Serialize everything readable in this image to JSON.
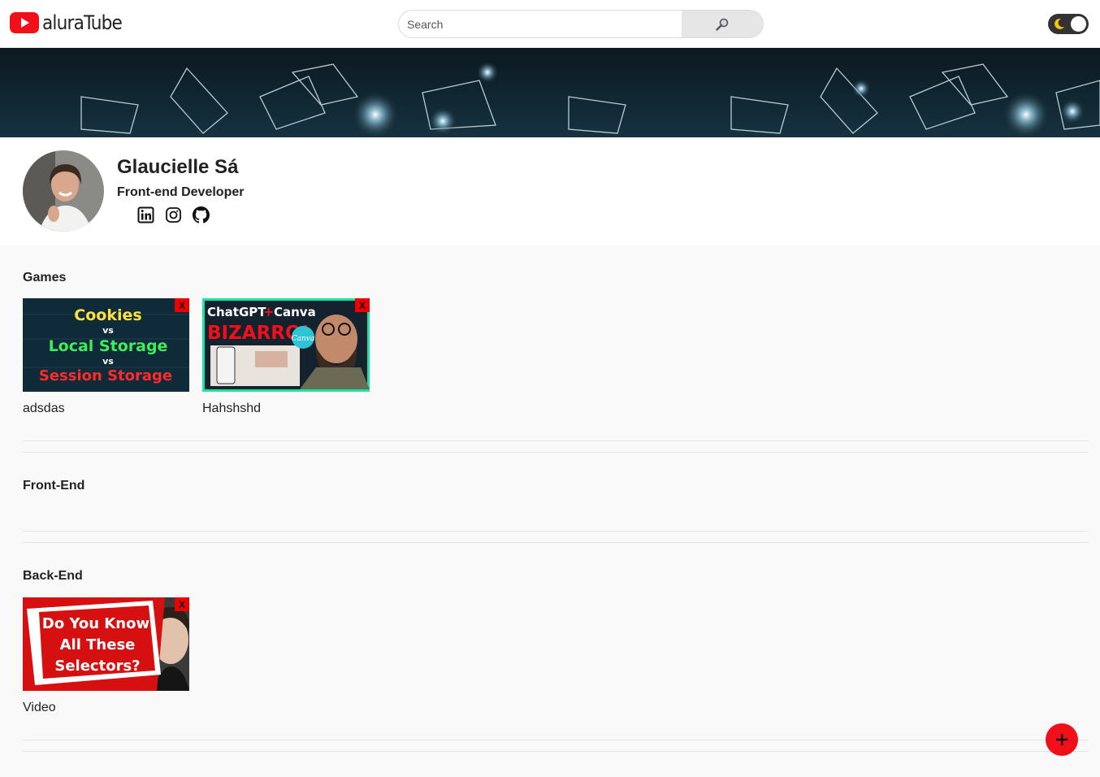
{
  "header": {
    "logo_text": "aluraTube",
    "search_placeholder": "Search",
    "search_icon": "magnifier-icon",
    "theme_icon": "moon-icon"
  },
  "profile": {
    "name": "Glaucielle Sá",
    "title": "Front-end Developer",
    "socials": [
      "linkedin-icon",
      "instagram-icon",
      "github-icon"
    ]
  },
  "sections": [
    {
      "title": "Games",
      "videos": [
        {
          "title": "adsdas",
          "thumb_lines": [
            "Cookies",
            "vs",
            "Local Storage",
            "vs",
            "Session Storage"
          ]
        },
        {
          "title": "Hahshshd",
          "thumb_lines": [
            "ChatGPT",
            "Canva",
            "BIZARRO!",
            "Canva"
          ]
        }
      ]
    },
    {
      "title": "Front-End",
      "videos": []
    },
    {
      "title": "Back-End",
      "videos": [
        {
          "title": "Video",
          "thumb_lines": [
            "Do You Know",
            "All These",
            "Selectors?"
          ]
        }
      ]
    }
  ],
  "delete_label": "X",
  "colors": {
    "accent": "#f10f1a",
    "background": "#f9f9f9",
    "header": "#ffffff"
  }
}
